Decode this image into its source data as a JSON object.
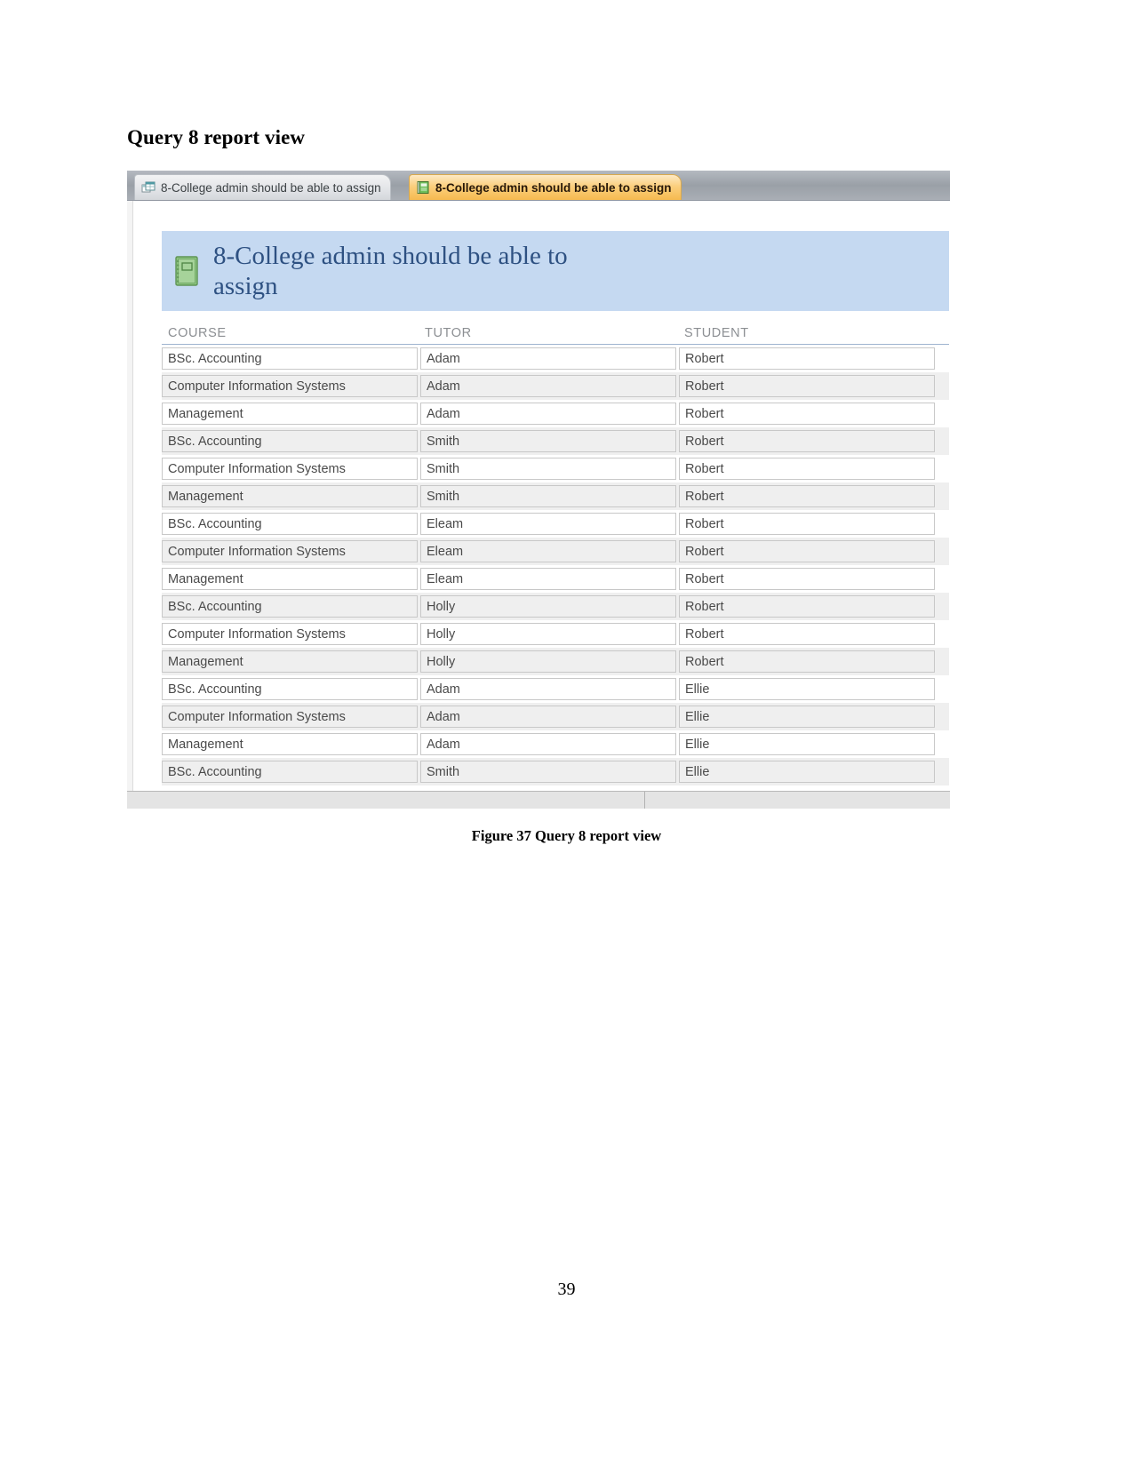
{
  "document": {
    "heading": "Query 8 report view",
    "caption": "Figure 37 Query 8 report view",
    "page_number": "39"
  },
  "app": {
    "tabs": [
      {
        "label": "8-College admin should be able to assign",
        "icon": "query-datasheet-icon",
        "active": false
      },
      {
        "label": "8-College admin should be able to assign",
        "icon": "report-icon",
        "active": true
      }
    ]
  },
  "report": {
    "title": "8-College admin should be able to assign",
    "title_icon": "report-document-icon",
    "banner_color": "#c5d9f1",
    "title_color": "#2e5182",
    "columns": [
      "COURSE",
      "TUTOR",
      "STUDENT"
    ],
    "rows": [
      [
        "BSc. Accounting",
        "Adam",
        "Robert"
      ],
      [
        "Computer Information Systems",
        "Adam",
        "Robert"
      ],
      [
        "Management",
        "Adam",
        "Robert"
      ],
      [
        "BSc. Accounting",
        "Smith",
        "Robert"
      ],
      [
        "Computer Information Systems",
        "Smith",
        "Robert"
      ],
      [
        "Management",
        "Smith",
        "Robert"
      ],
      [
        "BSc. Accounting",
        "Eleam",
        "Robert"
      ],
      [
        "Computer Information Systems",
        "Eleam",
        "Robert"
      ],
      [
        "Management",
        "Eleam",
        "Robert"
      ],
      [
        "BSc. Accounting",
        "Holly",
        "Robert"
      ],
      [
        "Computer Information Systems",
        "Holly",
        "Robert"
      ],
      [
        "Management",
        "Holly",
        "Robert"
      ],
      [
        "BSc. Accounting",
        "Adam",
        "Ellie"
      ],
      [
        "Computer Information Systems",
        "Adam",
        "Ellie"
      ],
      [
        "Management",
        "Adam",
        "Ellie"
      ],
      [
        "BSc. Accounting",
        "Smith",
        "Ellie"
      ]
    ]
  }
}
